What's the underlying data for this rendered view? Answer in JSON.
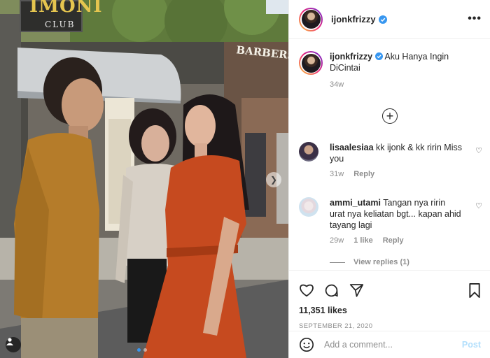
{
  "photo": {
    "sign_imoni_big": "IMONI",
    "sign_imoni_small": "CLUB",
    "sign_barber": "BARBERSHOP",
    "carousel_index": 1,
    "carousel_total": 2
  },
  "header": {
    "username": "ijonkfrizzy",
    "more_icon": "more-horizontal-icon",
    "verified_color": "#3897f0"
  },
  "caption": {
    "username": "ijonkfrizzy",
    "text": "Aku Hanya Ingin DiCintai",
    "time": "34w"
  },
  "comments": [
    {
      "username": "lisaalesiaa",
      "text": "kk ijonk & kk ririn Miss you",
      "time": "31w",
      "likes": "",
      "reply_label": "Reply"
    },
    {
      "username": "ammi_utami",
      "text": "Tangan nya ririn urat nya keliatan bgt... kapan ahid tayang lagi",
      "time": "29w",
      "likes": "1 like",
      "reply_label": "Reply"
    }
  ],
  "view_replies": "View replies (1)",
  "actions": {
    "icons": [
      "heart-icon",
      "comment-icon",
      "share-icon",
      "bookmark-icon"
    ],
    "likes": "11,351 likes",
    "date": "SEPTEMBER 21, 2020"
  },
  "add_comment": {
    "placeholder": "Add a comment...",
    "post_label": "Post",
    "post_color": "#b2dffc"
  }
}
